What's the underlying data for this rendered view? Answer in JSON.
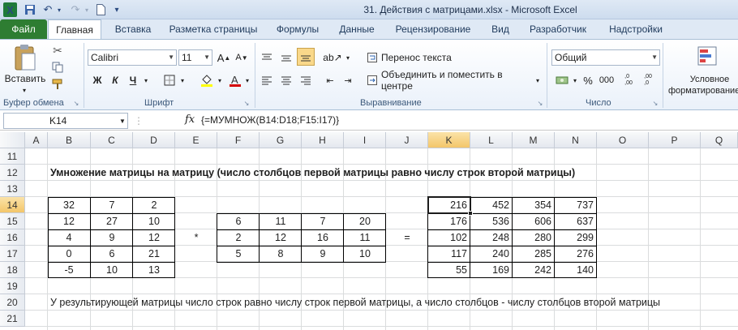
{
  "window": {
    "title": "31. Действия с матрицами.xlsx  -  Microsoft Excel"
  },
  "tabs": [
    "Файл",
    "Главная",
    "Вставка",
    "Разметка страницы",
    "Формулы",
    "Данные",
    "Рецензирование",
    "Вид",
    "Разработчик",
    "Надстройки"
  ],
  "ribbon": {
    "paste_label": "Вставить",
    "clipboard_label": "Буфер обмена",
    "font_name": "Calibri",
    "font_size": "11",
    "font_label": "Шрифт",
    "bold": "Ж",
    "italic": "К",
    "underline": "Ч",
    "wrap_text": "Перенос текста",
    "merge_center": "Объединить и поместить в центре",
    "alignment_label": "Выравнивание",
    "number_format": "Общий",
    "number_label": "Число",
    "percent": "%",
    "thousands": "000",
    "dec_inc": ",0\n,00",
    "dec_dec": ",00\n,0",
    "conditional": "Условное",
    "conditional2": "форматирование"
  },
  "formula_bar": {
    "cell_ref": "K14",
    "fx": "fx",
    "formula": "{=МУМНОЖ(B14:D18;F15:I17)}"
  },
  "sheet": {
    "columns": [
      "A",
      "B",
      "C",
      "D",
      "E",
      "F",
      "G",
      "H",
      "I",
      "J",
      "K",
      "L",
      "M",
      "N",
      "O",
      "P",
      "Q"
    ],
    "rows": [
      "11",
      "12",
      "13",
      "14",
      "15",
      "16",
      "17",
      "18",
      "19",
      "20",
      "21"
    ],
    "selected_column": "K",
    "selected_row": "14",
    "heading": "Умножение матрицы на матрицу (число столбцов первой матрицы равно числу строк второй матрицы)",
    "matrix_a": [
      [
        "32",
        "7",
        "2"
      ],
      [
        "12",
        "27",
        "10"
      ],
      [
        "4",
        "9",
        "12"
      ],
      [
        "0",
        "6",
        "21"
      ],
      [
        "-5",
        "10",
        "13"
      ]
    ],
    "multiply_sign": "*",
    "matrix_b": [
      [
        "6",
        "11",
        "7",
        "20"
      ],
      [
        "2",
        "12",
        "16",
        "11"
      ],
      [
        "5",
        "8",
        "9",
        "10"
      ]
    ],
    "equals_sign": "=",
    "result": [
      [
        "216",
        "452",
        "354",
        "737"
      ],
      [
        "176",
        "536",
        "606",
        "637"
      ],
      [
        "102",
        "248",
        "280",
        "299"
      ],
      [
        "117",
        "240",
        "285",
        "276"
      ],
      [
        "55",
        "169",
        "242",
        "140"
      ]
    ],
    "note": "У результирующей матрицы число строк равно числу строк первой матрицы, а число столбцов - числу столбцов второй матрицы"
  },
  "colors": {
    "file_tab": "#2e7d32",
    "selection": "#f3c66a",
    "ribbon_bg": "#eaf1fa"
  }
}
